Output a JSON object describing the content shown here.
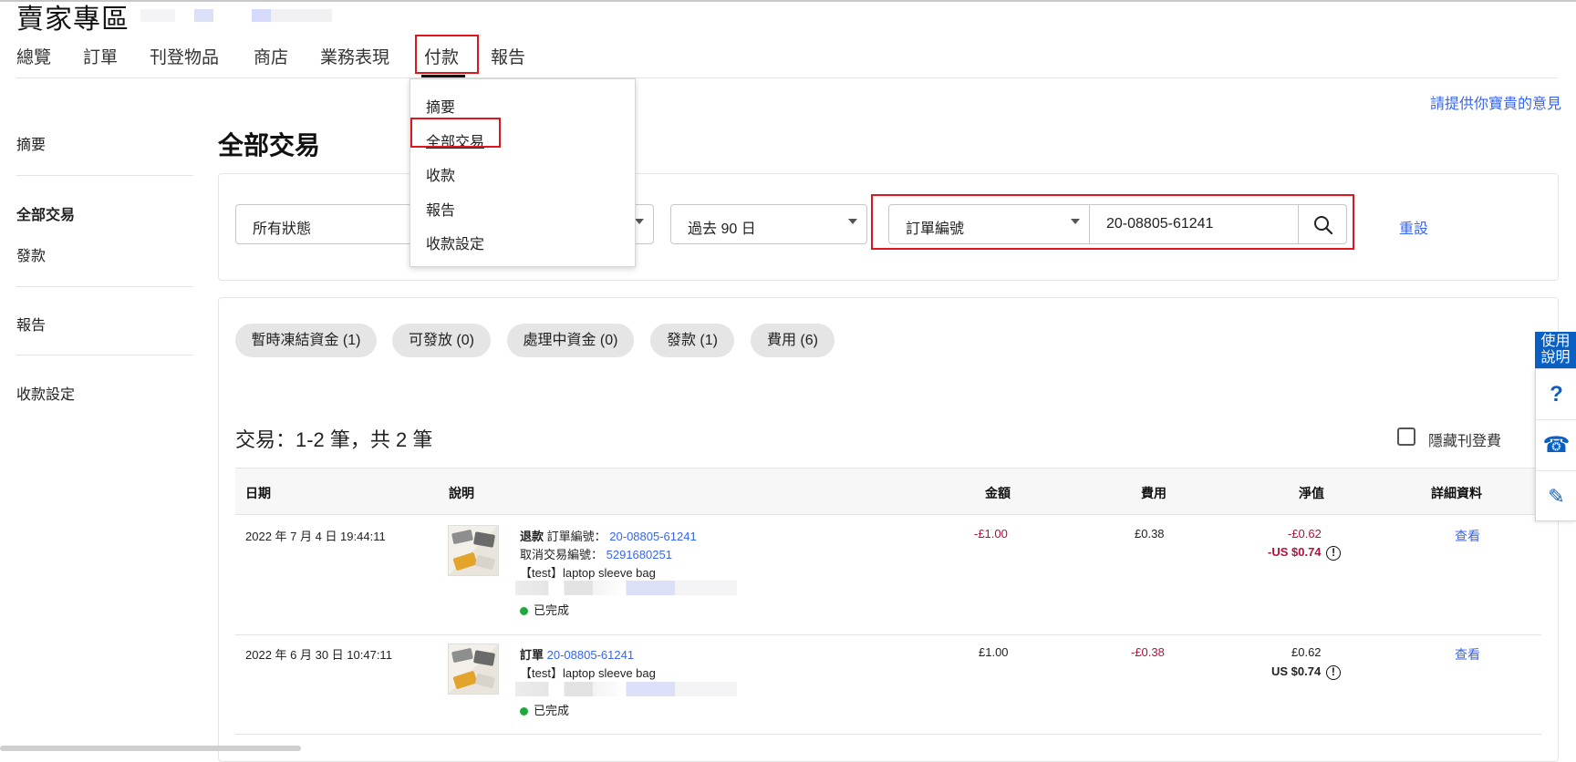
{
  "header": {
    "title": "賣家專區"
  },
  "topnav": {
    "items": [
      "總覽",
      "訂單",
      "刊登物品",
      "商店",
      "業務表現",
      "付款",
      "報告"
    ],
    "active": "付款"
  },
  "payment_menu": {
    "items": [
      "摘要",
      "全部交易",
      "收款",
      "報告",
      "收款設定"
    ],
    "highlighted": "全部交易"
  },
  "feedback_link": "請提供你寶貴的意見",
  "sidebar": {
    "items": [
      "摘要",
      "全部交易",
      "發款",
      "報告",
      "收款設定"
    ],
    "active": "全部交易"
  },
  "page_title": "全部交易",
  "filters": {
    "status": "所有狀態",
    "period": "過去 90 日",
    "search_type": "訂單編號",
    "search_value": "20-08805-61241",
    "reset": "重設"
  },
  "chips": [
    "暫時凍結資金 (1)",
    "可發放 (0)",
    "處理中資金 (0)",
    "發款 (1)",
    "費用 (6)"
  ],
  "results": {
    "count_label": "交易：1-2 筆，共 2 筆",
    "hide_fee_label": "隱藏刊登費"
  },
  "table": {
    "headers": [
      "日期",
      "說明",
      "金額",
      "費用",
      "淨值",
      "詳細資料"
    ],
    "rows": [
      {
        "date": "2022 年 7 月 4 日 19:44:11",
        "type": "退款",
        "order_prefix": "訂單編號：",
        "order_no": "20-08805-61241",
        "cancel_prefix": "取消交易編號：",
        "cancel_no": "5291680251",
        "item": "【test】laptop sleeve bag",
        "status": "已完成",
        "amount": "-£1.00",
        "fee": "£0.38",
        "net": "-£0.62",
        "net_usd": "-US $0.74",
        "detail": "查看"
      },
      {
        "date": "2022 年 6 月 30 日 10:47:11",
        "type": "訂單",
        "order_no": "20-08805-61241",
        "item": "【test】laptop sleeve bag",
        "status": "已完成",
        "amount": "£1.00",
        "fee": "-£0.38",
        "net": "£0.62",
        "net_usd": "US $0.74",
        "detail": "查看"
      }
    ]
  },
  "help_widget": {
    "tab_label": "使用說明",
    "buttons": [
      "?",
      "☎",
      "✎"
    ]
  },
  "colors": {
    "link": "#3665f3",
    "negative": "#b1123a",
    "highlight_box": "#e0161d",
    "help_blue": "#0a5fc2",
    "status_green": "#1fa83c"
  }
}
